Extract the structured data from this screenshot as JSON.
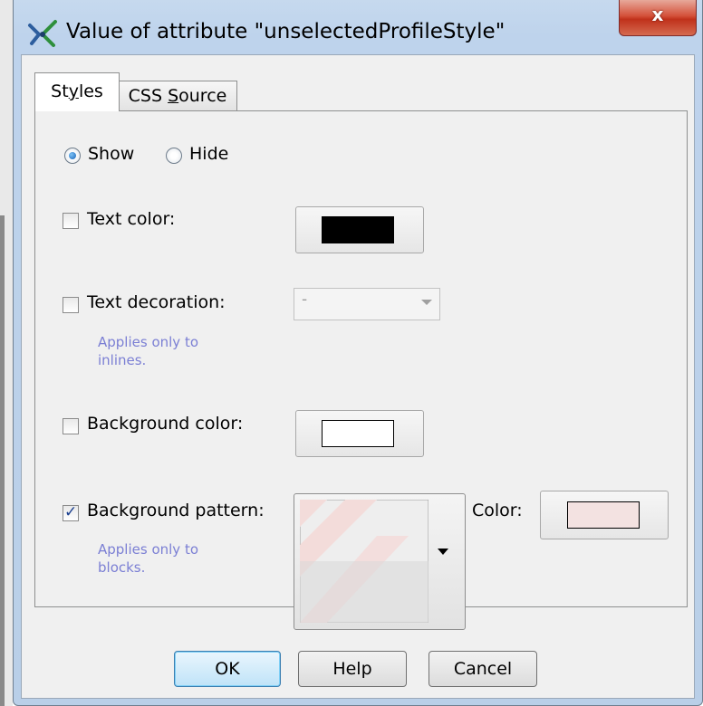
{
  "window": {
    "title": "Value of attribute \"unselectedProfileStyle\"",
    "close_label": "x"
  },
  "tabs": {
    "styles_prefix": "St",
    "styles_mnemonic": "y",
    "styles_suffix": "les",
    "css_prefix": "CSS ",
    "css_mnemonic": "S",
    "css_suffix": "ource",
    "active": "Styles"
  },
  "visibility": {
    "show_label": "Show",
    "hide_label": "Hide",
    "selected": "Show"
  },
  "text_color": {
    "label": "Text color:",
    "checked": false,
    "swatch_color": "#000000"
  },
  "text_decoration": {
    "label": "Text decoration:",
    "checked": false,
    "value": "-",
    "hint_line1": "Applies only to",
    "hint_line2": "inlines."
  },
  "background_color": {
    "label": "Background color:",
    "checked": false,
    "swatch_color": "#ffffff"
  },
  "background_pattern": {
    "label": "Background pattern:",
    "checked": true,
    "hint_line1": "Applies only to",
    "hint_line2": "blocks.",
    "color_label": "Color:",
    "swatch_color": "#f3e2e1"
  },
  "buttons": {
    "ok": "OK",
    "help": "Help",
    "cancel": "Cancel"
  },
  "colors": {
    "accent": "#1662b8",
    "hint_text": "#7b7fd4",
    "panel_bg": "#f0f0f0"
  }
}
